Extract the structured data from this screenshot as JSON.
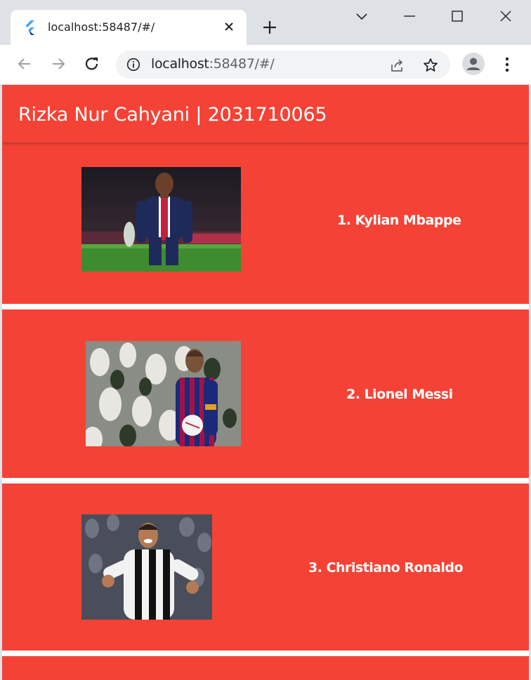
{
  "browser": {
    "tab_title": "localhost:58487/#/",
    "url_host": "localhost",
    "url_path": ":58487/#/"
  },
  "app": {
    "title": "Rizka Nur Cahyani | 2031710065",
    "accent_color": "#f44336",
    "players": [
      {
        "label": "1. Kylian Mbappe",
        "kit": "psg"
      },
      {
        "label": "2. Lionel Messi",
        "kit": "barcelona"
      },
      {
        "label": "3. Christiano Ronaldo",
        "kit": "juventus"
      }
    ]
  }
}
